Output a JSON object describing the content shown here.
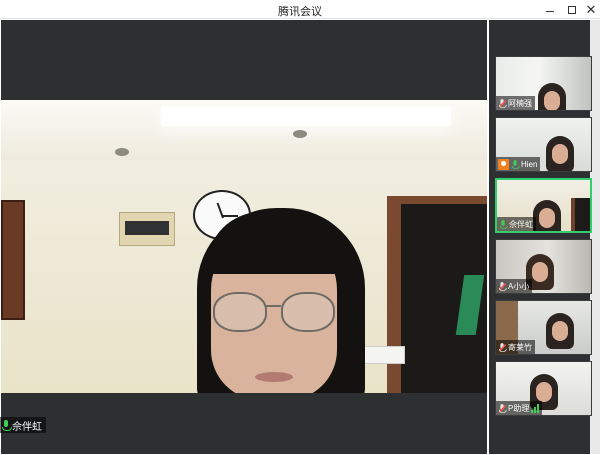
{
  "window": {
    "title": "腾讯会议",
    "minimize_icon": "minimize-icon",
    "maximize_icon": "maximize-icon",
    "close_icon": "close-icon",
    "close_glyph": "✕"
  },
  "main_video": {
    "speaker_name": "佘伴虹",
    "mic_state": "on"
  },
  "participants": [
    {
      "name": "阿楠强",
      "mic_state": "muted",
      "active": false
    },
    {
      "name": "Hien",
      "mic_state": "on",
      "active": false,
      "badge": "screen-share-icon"
    },
    {
      "name": "佘伴虹",
      "mic_state": "on",
      "active": true
    },
    {
      "name": "A小小",
      "mic_state": "muted",
      "active": false
    },
    {
      "name": "寄莱竹",
      "mic_state": "muted",
      "active": false
    },
    {
      "name": "P助理",
      "mic_state": "muted",
      "active": false,
      "signal": true
    }
  ],
  "colors": {
    "active_speaker_border": "#2fd06b",
    "mic_on": "#3fcf55",
    "mic_muted_slash": "#ff4d4d",
    "stage_bg": "#2d2f31"
  }
}
